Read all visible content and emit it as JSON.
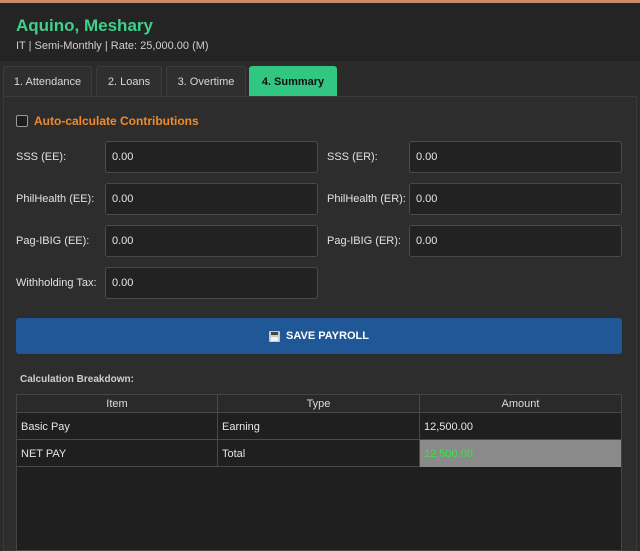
{
  "employee": {
    "name": "Aquino, Meshary",
    "subtitle": "IT | Semi-Monthly | Rate: 25,000.00 (M)"
  },
  "tabs": [
    {
      "label": "1. Attendance",
      "active": false
    },
    {
      "label": "2. Loans",
      "active": false
    },
    {
      "label": "3. Overtime",
      "active": false
    },
    {
      "label": "4. Summary",
      "active": true
    }
  ],
  "contributions": {
    "auto_label": "Auto-calculate Contributions",
    "auto_checked": false,
    "sss_ee": {
      "label": "SSS (EE):",
      "value": "0.00"
    },
    "sss_er": {
      "label": "SSS (ER):",
      "value": "0.00"
    },
    "philhealth_ee": {
      "label": "PhilHealth (EE):",
      "value": "0.00"
    },
    "philhealth_er": {
      "label": "PhilHealth (ER):",
      "value": "0.00"
    },
    "pagibig_ee": {
      "label": "Pag-IBIG (EE):",
      "value": "0.00"
    },
    "pagibig_er": {
      "label": "Pag-IBIG (ER):",
      "value": "0.00"
    },
    "withholding_tax": {
      "label": "Withholding Tax:",
      "value": "0.00"
    }
  },
  "save_button": {
    "label": "SAVE PAYROLL",
    "icon": "floppy-disk-icon"
  },
  "breakdown": {
    "title": "Calculation Breakdown:",
    "columns": [
      "Item",
      "Type",
      "Amount"
    ],
    "rows": [
      {
        "item": "Basic Pay",
        "type": "Earning",
        "amount": "12,500.00"
      },
      {
        "item": "NET PAY",
        "type": "Total",
        "amount": "12,500.00"
      }
    ]
  },
  "colors": {
    "accent_green": "#32c683",
    "name_green": "#3fd08a",
    "orange_label": "#f08a2c",
    "save_blue": "#1f5797",
    "net_pay_text": "#3fe04a"
  }
}
